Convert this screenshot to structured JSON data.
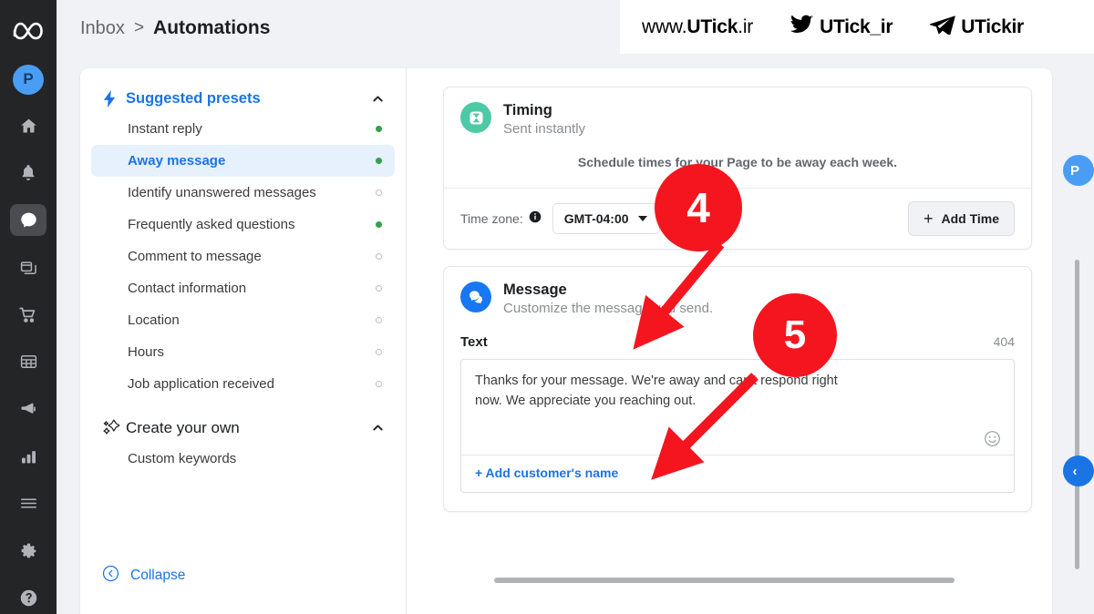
{
  "rail": {
    "logo_icon": "meta-logo",
    "avatar_initial": "P",
    "items": [
      {
        "icon": "home-icon",
        "name": "home"
      },
      {
        "icon": "bell-icon",
        "name": "notifications"
      },
      {
        "icon": "chat-bubble-icon",
        "name": "inbox",
        "active": true
      },
      {
        "icon": "pages-icon",
        "name": "pages"
      },
      {
        "icon": "shopping-cart-icon",
        "name": "commerce"
      },
      {
        "icon": "grid-table-icon",
        "name": "planner"
      },
      {
        "icon": "megaphone-icon",
        "name": "ads"
      },
      {
        "icon": "bar-chart-icon",
        "name": "insights"
      },
      {
        "icon": "list-lines-icon",
        "name": "more"
      },
      {
        "icon": "gear-icon",
        "name": "settings"
      },
      {
        "icon": "question-circle-icon",
        "name": "help"
      }
    ]
  },
  "header": {
    "breadcrumb_parent": "Inbox",
    "breadcrumb_separator": ">",
    "breadcrumb_current": "Automations"
  },
  "watermark": {
    "site_light": "www.",
    "site_bold": "UTick",
    "site_tld": ".ir",
    "twitter_handle": "UTick_ir",
    "twitter_icon": "twitter-bird-icon",
    "telegram_handle": "UTickir",
    "telegram_icon": "telegram-plane-icon"
  },
  "presets": {
    "suggested": {
      "label": "Suggested presets",
      "icon": "lightning-bolt-icon",
      "chevron": "chevron-up-icon",
      "items": [
        {
          "label": "Instant reply",
          "status": "on"
        },
        {
          "label": "Away message",
          "status": "on",
          "selected": true
        },
        {
          "label": "Identify unanswered messages",
          "status": "off"
        },
        {
          "label": "Frequently asked questions",
          "status": "on"
        },
        {
          "label": "Comment to message",
          "status": "off"
        },
        {
          "label": "Contact information",
          "status": "off"
        },
        {
          "label": "Location",
          "status": "off"
        },
        {
          "label": "Hours",
          "status": "off"
        },
        {
          "label": "Job application received",
          "status": "off"
        }
      ]
    },
    "create_your_own": {
      "label": "Create your own",
      "icon": "sparkle-icon",
      "chevron": "chevron-up-icon",
      "items": [
        {
          "label": "Custom keywords",
          "status": "none"
        }
      ]
    },
    "collapse": {
      "label": "Collapse",
      "icon": "chevron-left-circle-icon"
    }
  },
  "timing_card": {
    "icon": "hourglass-icon",
    "icon_color": "#4ec9a6",
    "title": "Timing",
    "subtitle": "Sent instantly",
    "schedule_note": "Schedule times for your Page to be away each week.",
    "timezone_label": "Time zone:",
    "info_icon": "info-circle-icon",
    "timezone_value": "GMT-04:00",
    "timezone_caret": "chevron-down-icon",
    "add_time_label": "Add Time",
    "add_time_icon": "plus-icon"
  },
  "message_card": {
    "icon": "chat-bubbles-icon",
    "icon_color": "#1877f2",
    "title": "Message",
    "subtitle": "Customize the message you send.",
    "text_label": "Text",
    "char_counter": "404",
    "message_value": "Thanks for your message. We're away and can't respond right now. We appreciate you reaching out.",
    "emoji_icon": "smiley-face-icon",
    "add_customer_name_label": "+ Add customer's name"
  },
  "edge_widgets": [
    {
      "label": "P",
      "name": "edge-avatar-chip"
    },
    {
      "label": "‹",
      "name": "edge-arrow-chip"
    }
  ],
  "annotations": [
    {
      "number": "4",
      "color": "#f5151f"
    },
    {
      "number": "5",
      "color": "#f5151f"
    }
  ]
}
